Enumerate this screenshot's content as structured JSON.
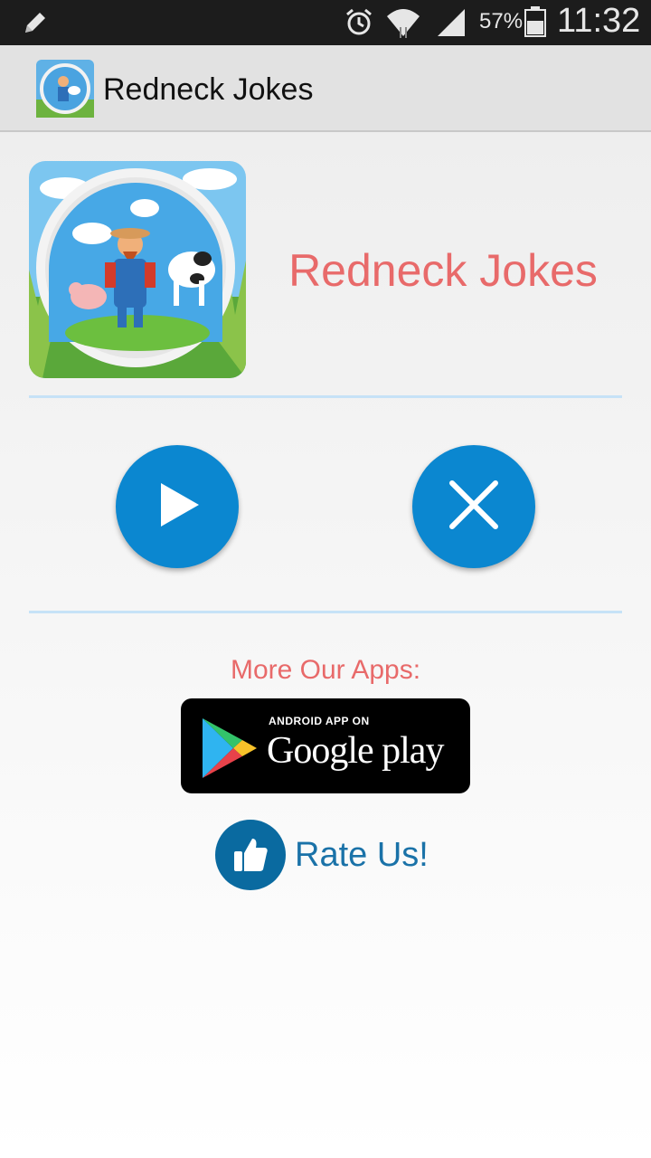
{
  "status_bar": {
    "battery_percent": "57%",
    "time": "11:32",
    "icons": [
      "pencil-icon",
      "alarm-icon",
      "wifi-icon",
      "signal-icon",
      "battery-icon"
    ]
  },
  "action_bar": {
    "title": "Redneck Jokes",
    "icon": "app-logo-farmer"
  },
  "header": {
    "title": "Redneck Jokes",
    "image": "farmer-cow-pig-illustration"
  },
  "controls": {
    "play": "play-icon",
    "close": "close-icon"
  },
  "more_apps": {
    "label": "More Our Apps:",
    "badge_top": "ANDROID APP ON",
    "badge_brand": "Google play"
  },
  "rate": {
    "label": "Rate Us!",
    "icon": "thumbs-up-icon"
  },
  "colors": {
    "accent_blue": "#0b87d0",
    "title_red": "#e86a6a",
    "divider": "#c6e2f7"
  }
}
